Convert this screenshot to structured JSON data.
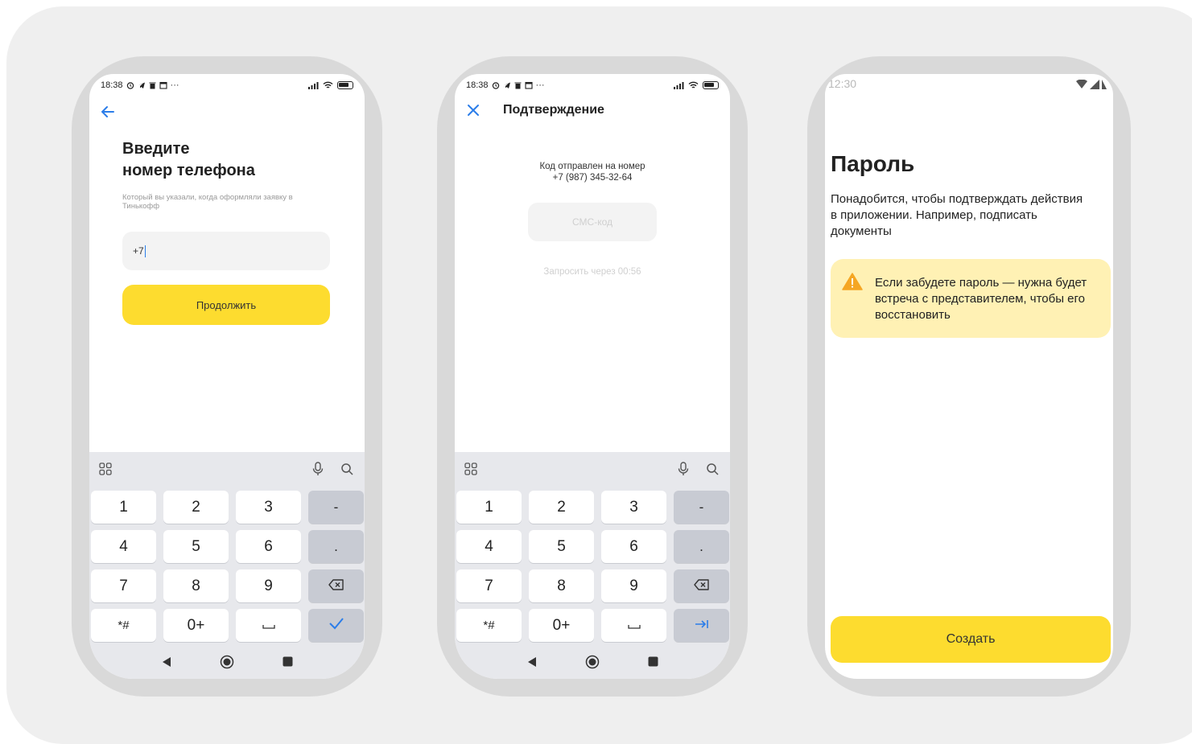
{
  "phone1": {
    "status_time": "18:38",
    "title": "Введите\nномер телефона",
    "title_line1": "Введите",
    "title_line2": "номер телефона",
    "subtitle": "Который вы указали, когда оформляли заявку в Тинькофф",
    "phone_value": "+7",
    "continue_label": "Продолжить",
    "confirm_key_icon": "checkmark-icon"
  },
  "phone2": {
    "status_time": "18:38",
    "header_title": "Подтверждение",
    "sent_label": "Код отправлен на номер",
    "phone_number": "+7 (987) 345-32-64",
    "sms_placeholder": "СМС-код",
    "resend_text": "Запросить через 00:56",
    "confirm_key_icon": "next-field-icon"
  },
  "phone3": {
    "status_time": "12:30",
    "title": "Пароль",
    "description": "Понадобится, чтобы подтверждать действия в приложении. Например, подписать документы",
    "warning": "Если забудете пароль — нужна будет встреча с представителем, чтобы его восстановить",
    "create_label": "Создать"
  },
  "keyboard": {
    "keys": [
      "1",
      "2",
      "3",
      "-",
      "4",
      "5",
      "6",
      ".",
      "7",
      "8",
      "9",
      "backspace",
      "*#",
      "0+",
      "space",
      "enter"
    ]
  },
  "colors": {
    "accent_yellow": "#fddc2f",
    "warning_bg": "#fff1b4",
    "link_blue": "#2b7de9",
    "warning_icon": "#f5a623"
  }
}
